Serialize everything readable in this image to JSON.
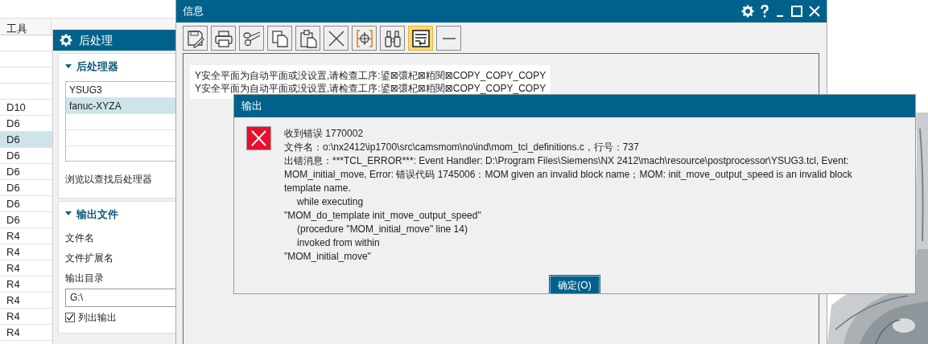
{
  "tool_table": {
    "columns": [
      "工具"
    ],
    "rows": [
      {
        "selected": false
      },
      {
        "selected": false
      },
      {
        "selected": false
      },
      {
        "selected": false
      },
      {
        "tool": "D10",
        "selected": false
      },
      {
        "tool": "D6",
        "selected": false
      },
      {
        "tool": "D6",
        "selected": true
      },
      {
        "tool": "D6",
        "selected": false
      },
      {
        "tool": "D6",
        "selected": false
      },
      {
        "tool": "D6",
        "selected": false
      },
      {
        "tool": "D6",
        "selected": false
      },
      {
        "tool": "D6",
        "selected": false
      },
      {
        "tool": "R4",
        "selected": false
      },
      {
        "tool": "R4",
        "selected": false
      },
      {
        "tool": "R4",
        "selected": false
      },
      {
        "tool": "R4",
        "selected": false
      },
      {
        "tool": "R4",
        "selected": false
      },
      {
        "tool": "R4",
        "selected": false
      },
      {
        "tool": "R4",
        "selected": false
      }
    ]
  },
  "postprocess_dialog": {
    "title": "后处理",
    "postprocessor_section": {
      "title": "后处理器",
      "expanded": true,
      "items": [
        {
          "label": "YSUG3",
          "selected": false
        },
        {
          "label": "fanuc-XYZA",
          "selected": true
        }
      ],
      "browse_label": "浏览以查找后处理器"
    },
    "output_file_section": {
      "title": "输出文件",
      "expanded": true,
      "labels": [
        "文件名",
        "文件扩展名",
        "输出目录"
      ],
      "directory_value": "G:\\",
      "list_output": {
        "label": "列出输出",
        "checked": true
      }
    }
  },
  "info_window": {
    "title": "信息",
    "toolbar": [
      {
        "kind": "save",
        "selected": false
      },
      {
        "kind": "print",
        "selected": false
      },
      {
        "kind": "cut",
        "selected": false
      },
      {
        "kind": "copy",
        "selected": false
      },
      {
        "kind": "paste",
        "selected": false
      },
      {
        "kind": "delete",
        "selected": false
      },
      {
        "kind": "target",
        "selected": false
      },
      {
        "kind": "find",
        "selected": false
      },
      {
        "kind": "wrap",
        "selected": true
      },
      {
        "kind": "minus",
        "selected": false
      }
    ],
    "text_lines": [
      "Y安全平面为自动平面或没设置,请检查工序:鍙⊠彋杞⊠粨閱⊠COPY_COPY_COPY",
      "Y安全平面为自动平面或没设置,请检查工序:鍙⊠彋杞⊠粨閱⊠COPY_COPY_COPY"
    ]
  },
  "error_dialog": {
    "title": "输出",
    "lines": [
      {
        "text": "收到错误 1770002",
        "indent": false
      },
      {
        "text": "文件名：o:\\nx2412\\ip1700\\src\\camsmom\\no\\ind\\mom_tcl_definitions.c，行号：737",
        "indent": false
      },
      {
        "text": "出错消息：***TCL_ERROR***: Event Handler: D:\\Program Files\\Siemens\\NX 2412\\mach\\resource\\postprocessor\\YSUG3.tcl, Event:",
        "indent": false
      },
      {
        "text": "MOM_initial_move, Error: 错误代码 1745006：MOM given an invalid block name；MOM: init_move_output_speed is an invalid block",
        "indent": false
      },
      {
        "text": "template name.",
        "indent": false
      },
      {
        "text": "while executing",
        "indent": true
      },
      {
        "text": "\"MOM_do_template init_move_output_speed\"",
        "indent": false
      },
      {
        "text": "(procedure \"MOM_initial_move\" line 14)",
        "indent": true
      },
      {
        "text": "invoked from within",
        "indent": true
      },
      {
        "text": "\"MOM_initial_move\"",
        "indent": false
      }
    ],
    "ok_button": "确定(O)"
  }
}
